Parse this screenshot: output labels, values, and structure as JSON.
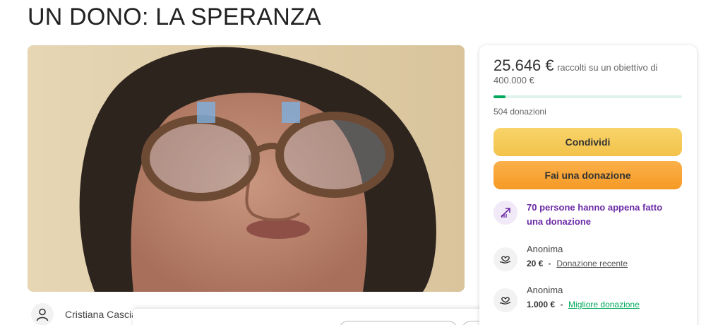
{
  "page": {
    "title": "UN DONO: LA SPERANZA"
  },
  "organizer": {
    "name": "Cristiana Cascia"
  },
  "fundraiser": {
    "raised_amount": "25.646 €",
    "raised_text": "raccolti su un obiettivo di 400.000 €",
    "progress_fraction": 0.064,
    "donations_count": "504 donazioni",
    "share_label": "Condividi",
    "donate_label": "Fai una donazione",
    "recent_activity": "70 persone hanno appena fatto una donazione",
    "donors": [
      {
        "name": "Anonima",
        "amount": "20 €",
        "tag": "Donazione recente"
      },
      {
        "name": "Anonima",
        "amount": "1.000 €",
        "tag": "Migliore donazione"
      }
    ]
  },
  "colors": {
    "progress": "#02a95c",
    "share": "#f5c94f",
    "donate": "#f8a12e",
    "activity": "#6b2aa6"
  }
}
